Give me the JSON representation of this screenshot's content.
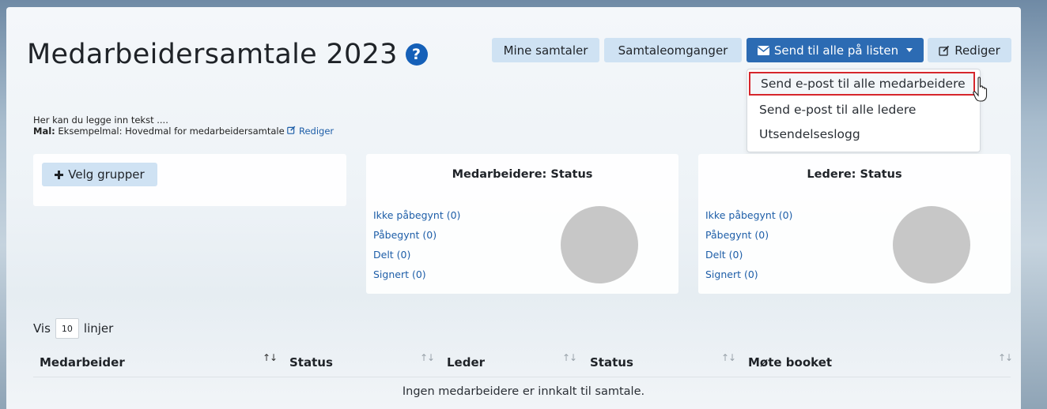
{
  "page": {
    "title": "Medarbeidersamtale 2023",
    "help_icon": "question-circle-icon"
  },
  "toolbar": {
    "mine_samtaler": "Mine samtaler",
    "samtaleomganger": "Samtaleomganger",
    "send_til_alle": "Send til alle på listen",
    "rediger": "Rediger"
  },
  "dropdown": {
    "items": [
      "Send e-post til alle medarbeidere",
      "Send e-post til alle ledere",
      "Utsendelseslogg"
    ]
  },
  "intro": {
    "text": "Her kan du legge inn tekst ....",
    "mal_label": "Mal:",
    "mal_value": "Eksempelmal: Hovedmal for medarbeidersamtale",
    "mal_edit": "Rediger"
  },
  "groups": {
    "button": "Velg grupper"
  },
  "medarbeidere_panel": {
    "title": "Medarbeidere: Status",
    "stats": [
      "Ikke påbegynt (0)",
      "Påbegynt (0)",
      "Delt (0)",
      "Signert (0)"
    ]
  },
  "ledere_panel": {
    "title": "Ledere: Status",
    "stats": [
      "Ikke påbegynt (0)",
      "Påbegynt (0)",
      "Delt (0)",
      "Signert (0)"
    ]
  },
  "table": {
    "show_label": "Vis",
    "page_size": "10",
    "lines_label": "linjer",
    "columns": [
      "Medarbeider",
      "Status",
      "Leder",
      "Status",
      "Møte booket"
    ],
    "empty_message": "Ingen medarbeidere er innkalt til samtale."
  },
  "colors": {
    "primary": "#2c6bb3",
    "light_button": "#cfe2f3",
    "highlight": "#d6262c",
    "link": "#1e5ea8",
    "pie": "#c7c7c7"
  }
}
